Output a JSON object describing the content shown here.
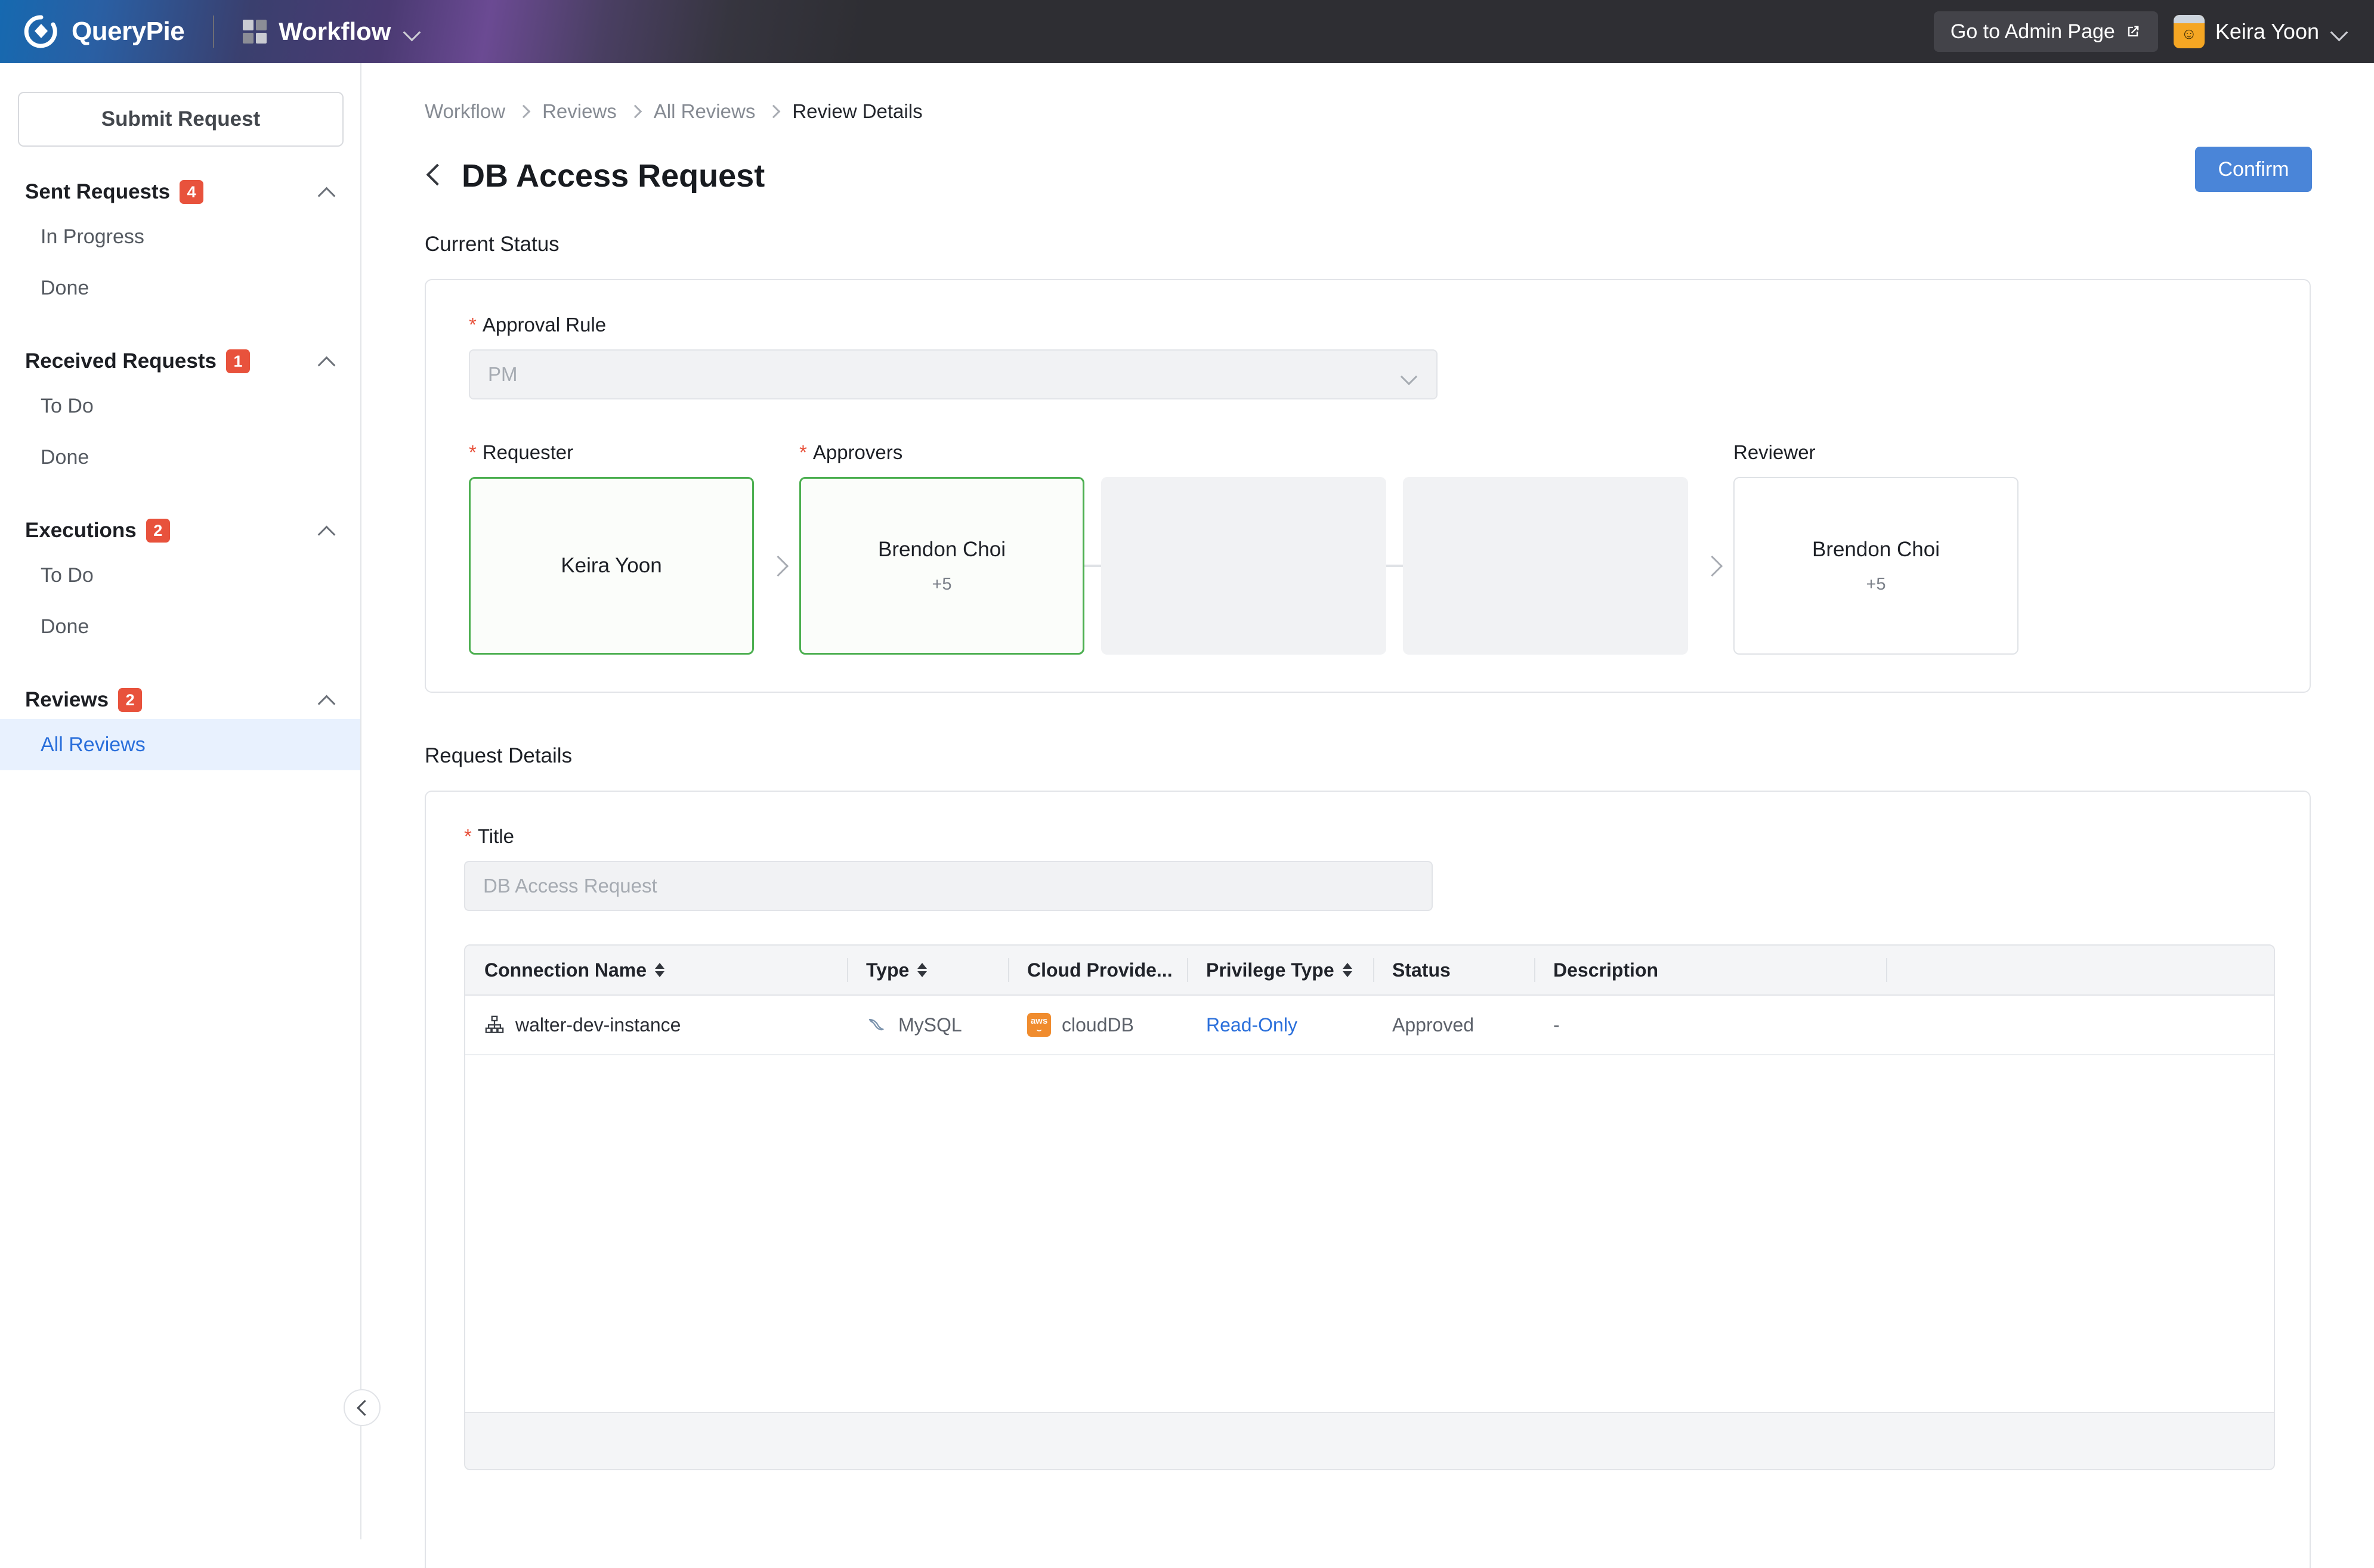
{
  "topbar": {
    "brand": "QueryPie",
    "app_name": "Workflow",
    "admin_button": "Go to Admin Page",
    "user_name": "Keira Yoon",
    "icons": {
      "logo": "querypie-logo-icon",
      "grid": "app-grid-icon",
      "chevron": "chevron-down-icon",
      "external": "external-link-icon",
      "avatar": "avatar-icon"
    },
    "colors": {
      "bar_bg": "#2e2e33",
      "admin_btn_bg": "#434349",
      "avatar_bg": "#f5a623"
    }
  },
  "sidebar": {
    "submit_label": "Submit Request",
    "groups": [
      {
        "title": "Sent Requests",
        "badge": "4",
        "items": [
          {
            "label": "In Progress",
            "selected": false
          },
          {
            "label": "Done",
            "selected": false
          }
        ]
      },
      {
        "title": "Received Requests",
        "badge": "1",
        "items": [
          {
            "label": "To Do",
            "selected": false
          },
          {
            "label": "Done",
            "selected": false
          }
        ]
      },
      {
        "title": "Executions",
        "badge": "2",
        "items": [
          {
            "label": "To Do",
            "selected": false
          },
          {
            "label": "Done",
            "selected": false
          }
        ]
      },
      {
        "title": "Reviews",
        "badge": "2",
        "items": [
          {
            "label": "All Reviews",
            "selected": true
          }
        ]
      }
    ],
    "collapse_icon": "chevron-left-icon",
    "colors": {
      "badge_bg": "#e8523c",
      "selected_bg": "#e8f1fe",
      "selected_fg": "#2a6fdb"
    }
  },
  "breadcrumb": [
    {
      "label": "Workflow",
      "current": false
    },
    {
      "label": "Reviews",
      "current": false
    },
    {
      "label": "All Reviews",
      "current": false
    },
    {
      "label": "Review Details",
      "current": true
    }
  ],
  "header": {
    "title": "DB Access Request",
    "back_icon": "chevron-left-icon",
    "confirm_label": "Confirm",
    "confirm_color": "#4a85d8"
  },
  "current_status": {
    "section_label": "Current Status",
    "approval_rule": {
      "label": "Approval Rule",
      "required": true,
      "value": "PM",
      "disabled": true,
      "chevron_icon": "chevron-down-icon"
    },
    "flow": {
      "requester": {
        "label": "Requester",
        "required": true,
        "name": "Keira Yoon",
        "more": "",
        "state": "active"
      },
      "approvers": {
        "label": "Approvers",
        "required": true,
        "name": "Brendon Choi",
        "more": "+5",
        "state": "active"
      },
      "empty_slots": 2,
      "reviewer": {
        "label": "Reviewer",
        "required": false,
        "name": "Brendon Choi",
        "more": "+5",
        "state": "plain"
      }
    },
    "active_border_color": "#4caf50"
  },
  "request_details": {
    "section_label": "Request Details",
    "title_field": {
      "label": "Title",
      "required": true,
      "value": "DB Access Request",
      "disabled": true
    },
    "table": {
      "columns": [
        {
          "key": "connection_name",
          "label": "Connection Name",
          "sortable": true
        },
        {
          "key": "type",
          "label": "Type",
          "sortable": true
        },
        {
          "key": "cloud_provider",
          "label": "Cloud Provide...",
          "sortable": false
        },
        {
          "key": "privilege_type",
          "label": "Privilege Type",
          "sortable": true
        },
        {
          "key": "status",
          "label": "Status",
          "sortable": false
        },
        {
          "key": "description",
          "label": "Description",
          "sortable": false
        }
      ],
      "rows": [
        {
          "connection_name": "walter-dev-instance",
          "connection_icon": "sitemap-icon",
          "type": "MySQL",
          "type_icon": "mysql-dolphin-icon",
          "cloud_provider": "cloudDB",
          "cloud_icon": "aws-icon",
          "privilege_type": "Read-Only",
          "status": "Approved",
          "description": "-"
        }
      ]
    }
  }
}
